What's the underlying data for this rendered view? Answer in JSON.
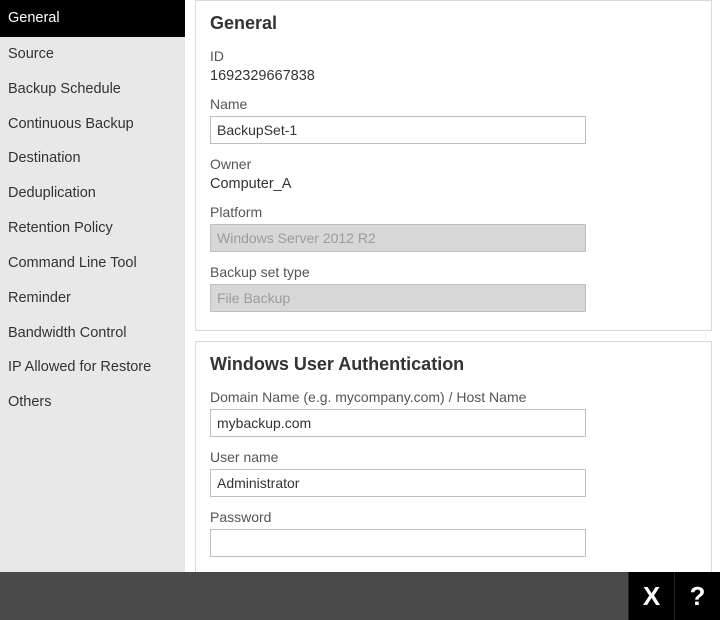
{
  "sidebar": {
    "items": [
      {
        "label": "General",
        "active": true
      },
      {
        "label": "Source",
        "active": false
      },
      {
        "label": "Backup Schedule",
        "active": false
      },
      {
        "label": "Continuous Backup",
        "active": false
      },
      {
        "label": "Destination",
        "active": false
      },
      {
        "label": "Deduplication",
        "active": false
      },
      {
        "label": "Retention Policy",
        "active": false
      },
      {
        "label": "Command Line Tool",
        "active": false
      },
      {
        "label": "Reminder",
        "active": false
      },
      {
        "label": "Bandwidth Control",
        "active": false
      },
      {
        "label": "IP Allowed for Restore",
        "active": false
      },
      {
        "label": "Others",
        "active": false
      }
    ]
  },
  "general": {
    "title": "General",
    "id_label": "ID",
    "id_value": "1692329667838",
    "name_label": "Name",
    "name_value": "BackupSet-1",
    "owner_label": "Owner",
    "owner_value": "Computer_A",
    "platform_label": "Platform",
    "platform_value": "Windows Server 2012 R2",
    "type_label": "Backup set type",
    "type_value": "File Backup"
  },
  "auth": {
    "title": "Windows User Authentication",
    "domain_label": "Domain Name (e.g. mycompany.com) / Host Name",
    "domain_value": "mybackup.com",
    "username_label": "User name",
    "username_value": "Administrator",
    "password_label": "Password",
    "password_value": ""
  },
  "footer": {
    "close_glyph": "X",
    "help_glyph": "?"
  }
}
